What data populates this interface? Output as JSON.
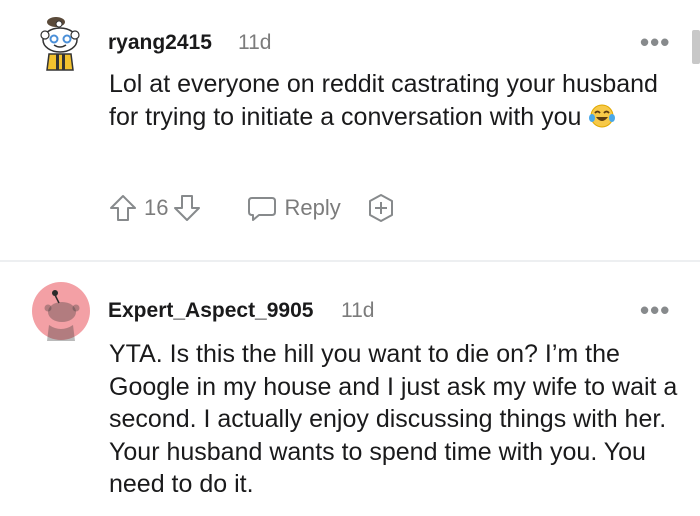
{
  "comments": [
    {
      "username": "ryang2415",
      "age": "11d",
      "body": "Lol at everyone on reddit castrating your husband for trying to initiate a conversation with you",
      "emoji": "face-with-tears-of-joy",
      "votes": "16",
      "reply_label": "Reply",
      "more_label": "•••"
    },
    {
      "username": "Expert_Aspect_9905",
      "age": "11d",
      "body": "YTA. Is this the hill you want to die on? I’m the Google in my house and I just ask my wife to wait a second. I actually enjoy discussing things with her. Your husband wants to spend time with you. You need to do it.",
      "more_label": "•••"
    }
  ],
  "colors": {
    "avatar_pink": "#f3a0a5",
    "muted": "#878a8c",
    "text": "#1a1a1b",
    "divider": "#edeff1"
  }
}
